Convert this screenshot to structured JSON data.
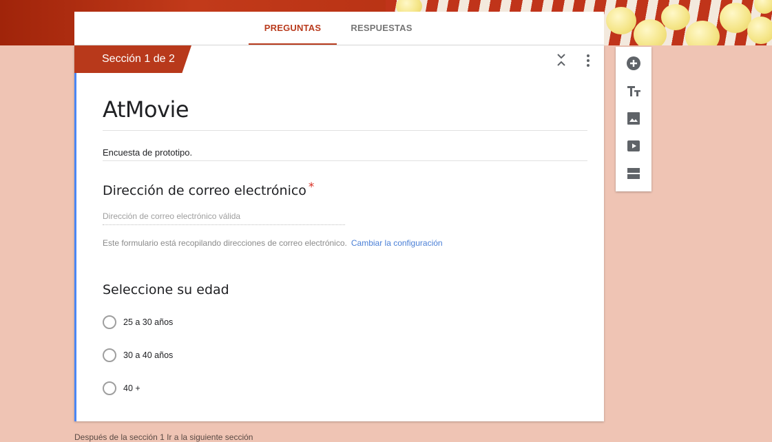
{
  "tabs": {
    "preguntas": "PREGUNTAS",
    "respuestas": "RESPUESTAS"
  },
  "section": {
    "label": "Sección 1 de 2"
  },
  "form": {
    "title": "AtMovie",
    "description": "Encuesta de prototipo."
  },
  "email_question": {
    "title": "Dirección de correo electrónico",
    "required_mark": "*",
    "placeholder": "Dirección de correo electrónico válida",
    "info": "Este formulario está recopilando direcciones de correo electrónico.",
    "link": "Cambiar la configuración"
  },
  "age_question": {
    "title": "Seleccione su edad",
    "options": [
      "25 a 30 años",
      "30 a 40 años",
      "40 +"
    ]
  },
  "footer": {
    "text": "Después de la sección 1  Ir a la siguiente sección"
  },
  "colors": {
    "accent": "#b93b1d",
    "background": "#efc4b4",
    "left_bar": "#4a86f5",
    "link": "#4a7fd6"
  },
  "icons": [
    "collapse-icon",
    "more-vert-icon",
    "add-circle-icon",
    "title-text-icon",
    "image-icon",
    "video-icon",
    "section-icon"
  ]
}
